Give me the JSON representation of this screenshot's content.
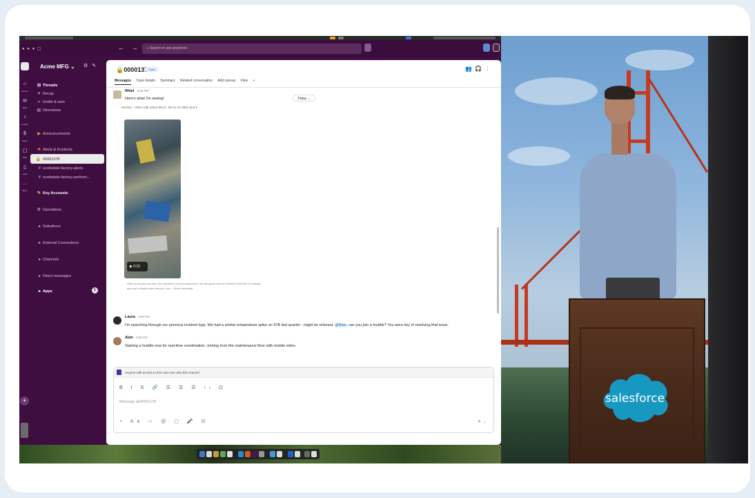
{
  "workspace": {
    "name": "Acme MFG",
    "chevron": "⌄"
  },
  "search": {
    "placeholder": "Search or ask anywhere"
  },
  "rail": {
    "items": [
      {
        "icon": "home-icon",
        "label": "Home"
      },
      {
        "icon": "dm-icon",
        "label": "DMs"
      },
      {
        "icon": "bell-icon",
        "label": "Activity"
      },
      {
        "icon": "sales-icon",
        "label": "Sales"
      },
      {
        "icon": "file-icon",
        "label": "Files"
      },
      {
        "icon": "later-icon",
        "label": "Later"
      },
      {
        "icon": "more-icon",
        "label": "More"
      }
    ]
  },
  "sidebar": {
    "items": [
      {
        "label": "Threads",
        "icon": "thread-icon",
        "bold": true
      },
      {
        "label": "Recap",
        "icon": "recap-icon"
      },
      {
        "label": "Drafts & sent",
        "icon": "send-icon"
      },
      {
        "label": "Directories",
        "icon": "directory-icon"
      },
      {
        "label": "Announcements",
        "icon": "megaphone-icon"
      },
      {
        "label": "Alerts & Incidents",
        "icon": "alert-icon"
      },
      {
        "label": "00001378",
        "icon": "lock-icon",
        "active": true
      },
      {
        "label": "scottsdale-factory-alerts",
        "icon": "hash-icon"
      },
      {
        "label": "scottsdale-factory-perform...",
        "icon": "hash-icon"
      },
      {
        "label": "Key Accounts",
        "icon": "star-icon",
        "bold": true
      },
      {
        "label": "Operations",
        "icon": "gear-icon"
      },
      {
        "label": "Salesforce",
        "icon": "caret-icon"
      },
      {
        "label": "External Connections",
        "icon": "caret-icon"
      },
      {
        "label": "Channels",
        "icon": "caret-icon"
      },
      {
        "label": "Direct messages",
        "icon": "caret-icon"
      },
      {
        "label": "Apps",
        "icon": "caret-icon",
        "bold": true,
        "badge": "1"
      }
    ]
  },
  "channel": {
    "title": "00001378",
    "tag": "Case",
    "tabs": [
      "Messages",
      "Case details",
      "Summary",
      "Related conversation",
      "Add canvas",
      "Files",
      "+"
    ]
  },
  "messages": [
    {
      "author": "Rhiel",
      "time": "3:56 PM",
      "text": "Here's what I'm seeing!",
      "file": "Kitchen · Video Clip (2024-09-17, 08-41-47-080).mp4 ▾"
    },
    {
      "author": "Laura",
      "time": "3:56 PM",
      "text_before": "I'm searching through our previous incident logs. We had a similar temperature spike on 47B last quarter - might be relevant.",
      "mention": "@Alan",
      "text_after": ", can you join a huddle? You were key in resolving that issue."
    },
    {
      "author": "Alan",
      "time": "3:56 PM",
      "text": "Starting a huddle now for real-time coordination. Joining from the maintenance floor with mobile video."
    }
  ],
  "date_divider": "Today ⌄",
  "video": {
    "duration": "0:15"
  },
  "caption": "Wait, so as you can see, the machine's a bit unresponsive, but the good news is it doesn't look like I'm seeing any sort of leaks down below it, so I... Show transcript",
  "composer": {
    "notice": "Anyone with access to this case can view this channel",
    "format_tools": "B I S 🔗 ☰ ☰ ☰ ‹› ⊡",
    "placeholder": "Message ⊕00001378",
    "bottom_tools": "+ Aa ☺ @ ▢ 🎤 ⊟",
    "send": "➤ ⌄"
  },
  "stage": {
    "logo_text": "salesforce"
  },
  "colors": {
    "slack_purple": "#3f0e40",
    "salesforce_blue": "#1798c1",
    "bridge_red": "#c63a22"
  }
}
